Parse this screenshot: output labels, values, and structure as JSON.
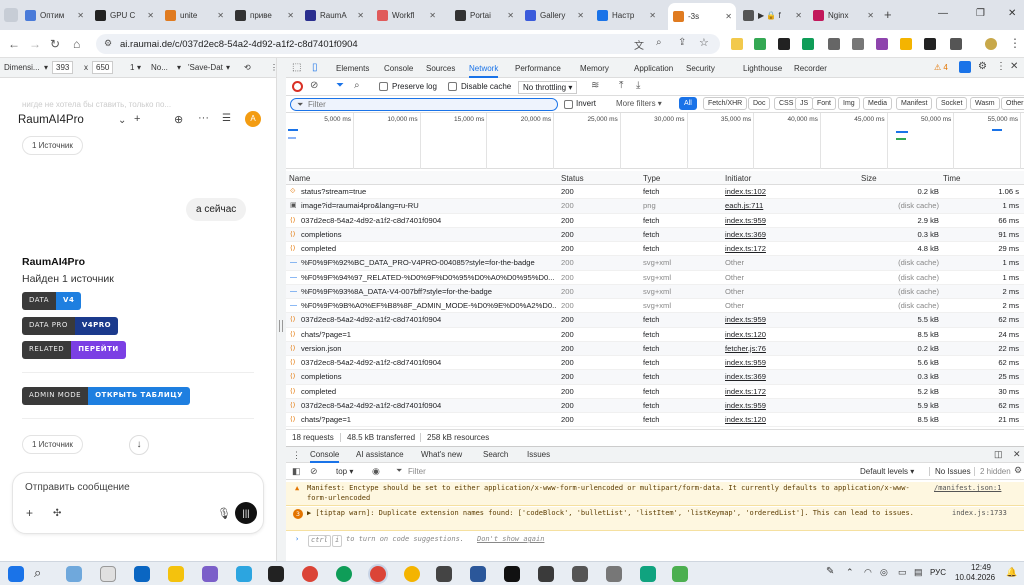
{
  "browser": {
    "tabs": [
      {
        "label": "Оптим",
        "color": "#4a7bd9"
      },
      {
        "label": "GPU C",
        "color": "#222222"
      },
      {
        "label": "unite",
        "color": "#e07b20"
      },
      {
        "label": "приве",
        "color": "#333333"
      },
      {
        "label": "RaumA",
        "color": "#2b2f8f"
      },
      {
        "label": "Workfl",
        "color": "#e05b5b"
      },
      {
        "label": "Portai",
        "color": "#333333"
      },
      {
        "label": "Gallery",
        "color": "#3b5bdb"
      },
      {
        "label": "Настр",
        "color": "#1a73e8"
      },
      {
        "label": "-3s",
        "color": "#e07b20"
      },
      {
        "label": "▶ 🔒 f",
        "color": "#555555"
      },
      {
        "label": "Nginx",
        "color": "#c2185b"
      }
    ],
    "url": "ai.raumai.de/c/037d2ec8-54a2-4d92-a1f2-c8d7401f0904",
    "new_tab": "+"
  },
  "device_toolbar": {
    "device": "Dimensi...",
    "width": "393",
    "x": "x",
    "height": "650",
    "zoom": "1",
    "throttle": "No...",
    "save": "'Save-Dat"
  },
  "page": {
    "faded_text": "нигде не хотела бы ставить, только по...",
    "app_title": "RaumAI4Pro",
    "avatar": "A",
    "sources_top": "1 Источник",
    "user_bubble": "а сейчас",
    "bot_name": "RaumAI4Pro",
    "found": "Найден 1 источник",
    "badges": [
      {
        "left": "DATA",
        "right": "V4",
        "color": "#1e7fe0"
      },
      {
        "left": "DATA PRO",
        "right": "V4PRO",
        "color": "#1b3a8c"
      },
      {
        "left": "RELATED",
        "right": "ПЕРЕЙТИ",
        "color": "#7b3fe4"
      }
    ],
    "admin_badge": {
      "left": "ADMIN MODE",
      "right": "ОТКРЫТЬ ТАБЛИЦУ",
      "color": "#1e7fe0"
    },
    "sources_bottom": "1 Источник",
    "input_placeholder": "Отправить сообщение"
  },
  "devtools": {
    "tabs": [
      "Elements",
      "Console",
      "Sources",
      "Network",
      "Performance",
      "Memory",
      "Application",
      "Security",
      "Lighthouse",
      "Recorder"
    ],
    "active_tab": "Network",
    "warnings": "4",
    "preserve_log": "Preserve log",
    "disable_cache": "Disable cache",
    "throttling": "No throttling",
    "filter_placeholder": "Filter",
    "invert": "Invert",
    "more_filters": "More filters ▾",
    "type_filters": [
      "All",
      "Fetch/XHR",
      "Doc",
      "CSS",
      "JS",
      "Font",
      "Img",
      "Media",
      "Manifest",
      "Socket",
      "Wasm",
      "Other"
    ],
    "timeline_ticks": [
      "5,000 ms",
      "10,000 ms",
      "15,000 ms",
      "20,000 ms",
      "25,000 ms",
      "30,000 ms",
      "35,000 ms",
      "40,000 ms",
      "45,000 ms",
      "50,000 ms",
      "55,000 ms"
    ],
    "columns": [
      "Name",
      "Status",
      "Type",
      "Initiator",
      "Size",
      "Time"
    ],
    "requests": [
      {
        "name": "status?stream=true",
        "status": "200",
        "type": "fetch",
        "initiator": "index.ts:102",
        "size": "0.2 kB",
        "time": "1.06 s",
        "icon": "doc"
      },
      {
        "name": "image?id=raumai4pro&lang=ru-RU",
        "status": "200",
        "type": "png",
        "initiator": "each.js:711",
        "size": "(disk cache)",
        "time": "1 ms",
        "icon": "img"
      },
      {
        "name": "037d2ec8-54a2-4d92-a1f2-c8d7401f0904",
        "status": "200",
        "type": "fetch",
        "initiator": "index.ts:959",
        "size": "2.9 kB",
        "time": "66 ms",
        "icon": "xhr"
      },
      {
        "name": "completions",
        "status": "200",
        "type": "fetch",
        "initiator": "index.ts:369",
        "size": "0.3 kB",
        "time": "91 ms",
        "icon": "xhr"
      },
      {
        "name": "completed",
        "status": "200",
        "type": "fetch",
        "initiator": "index.ts:172",
        "size": "4.8 kB",
        "time": "29 ms",
        "icon": "xhr"
      },
      {
        "name": "%F0%9F%92%BC_DATA_PRO-V4PRO-004085?style=for-the-badge",
        "status": "200",
        "type": "svg+xml",
        "initiator": "Other",
        "size": "(disk cache)",
        "time": "1 ms",
        "icon": "svg"
      },
      {
        "name": "%F0%9F%94%97_RELATED-%D0%9F%D0%95%D0%A0%D0%95%D0...",
        "status": "200",
        "type": "svg+xml",
        "initiator": "Other",
        "size": "(disk cache)",
        "time": "1 ms",
        "icon": "svg"
      },
      {
        "name": "%F0%9F%93%8A_DATA-V4-007bff?style=for-the-badge",
        "status": "200",
        "type": "svg+xml",
        "initiator": "Other",
        "size": "(disk cache)",
        "time": "2 ms",
        "icon": "svg"
      },
      {
        "name": "%F0%9F%9B%A0%EF%B8%8F_ADMIN_MODE-%D0%9E%D0%A2%D0...",
        "status": "200",
        "type": "svg+xml",
        "initiator": "Other",
        "size": "(disk cache)",
        "time": "2 ms",
        "icon": "svg"
      },
      {
        "name": "037d2ec8-54a2-4d92-a1f2-c8d7401f0904",
        "status": "200",
        "type": "fetch",
        "initiator": "index.ts:959",
        "size": "5.5 kB",
        "time": "62 ms",
        "icon": "xhr"
      },
      {
        "name": "chats/?page=1",
        "status": "200",
        "type": "fetch",
        "initiator": "index.ts:120",
        "size": "8.5 kB",
        "time": "24 ms",
        "icon": "xhr"
      },
      {
        "name": "version.json",
        "status": "200",
        "type": "fetch",
        "initiator": "fetcher.js:76",
        "size": "0.2 kB",
        "time": "22 ms",
        "icon": "xhr"
      },
      {
        "name": "037d2ec8-54a2-4d92-a1f2-c8d7401f0904",
        "status": "200",
        "type": "fetch",
        "initiator": "index.ts:959",
        "size": "5.6 kB",
        "time": "62 ms",
        "icon": "xhr"
      },
      {
        "name": "completions",
        "status": "200",
        "type": "fetch",
        "initiator": "index.ts:369",
        "size": "0.3 kB",
        "time": "25 ms",
        "icon": "xhr"
      },
      {
        "name": "completed",
        "status": "200",
        "type": "fetch",
        "initiator": "index.ts:172",
        "size": "5.2 kB",
        "time": "30 ms",
        "icon": "xhr"
      },
      {
        "name": "037d2ec8-54a2-4d92-a1f2-c8d7401f0904",
        "status": "200",
        "type": "fetch",
        "initiator": "index.ts:959",
        "size": "5.9 kB",
        "time": "62 ms",
        "icon": "xhr"
      },
      {
        "name": "chats/?page=1",
        "status": "200",
        "type": "fetch",
        "initiator": "index.ts:120",
        "size": "8.5 kB",
        "time": "21 ms",
        "icon": "xhr"
      }
    ],
    "summary": {
      "requests": "18 requests",
      "transferred": "48.5 kB transferred",
      "resources": "258 kB resources"
    },
    "drawer_tabs": [
      "Console",
      "AI assistance",
      "What's new",
      "Search",
      "Issues"
    ],
    "console_context": "top ▾",
    "console_filter": "Filter",
    "default_levels": "Default levels ▾",
    "no_issues": "No Issues",
    "hidden": "2 hidden",
    "messages": [
      {
        "kind": "warn",
        "text": "Manifest: Enctype should be set to either application/x-www-form-urlencoded or multipart/form-data. It currently defaults to application/x-www-form-urlencoded",
        "source": "/manifest.json:1"
      },
      {
        "kind": "warn",
        "count": "3",
        "text": "▶ [tiptap warn]: Duplicate extension names found: ['codeBlock', 'bulletList', 'listItem', 'listKeymap', 'orderedList']. This can lead to issues.",
        "source": "index.js:1733"
      }
    ],
    "prompt_hint_ctrl": "ctrl",
    "prompt_hint_i": "i",
    "prompt_hint_text": "to turn on code suggestions.",
    "prompt_hint_link": "Don't show again"
  },
  "taskbar": {
    "lang": "РУС",
    "time": "12:49",
    "date": "10.04.2026"
  }
}
